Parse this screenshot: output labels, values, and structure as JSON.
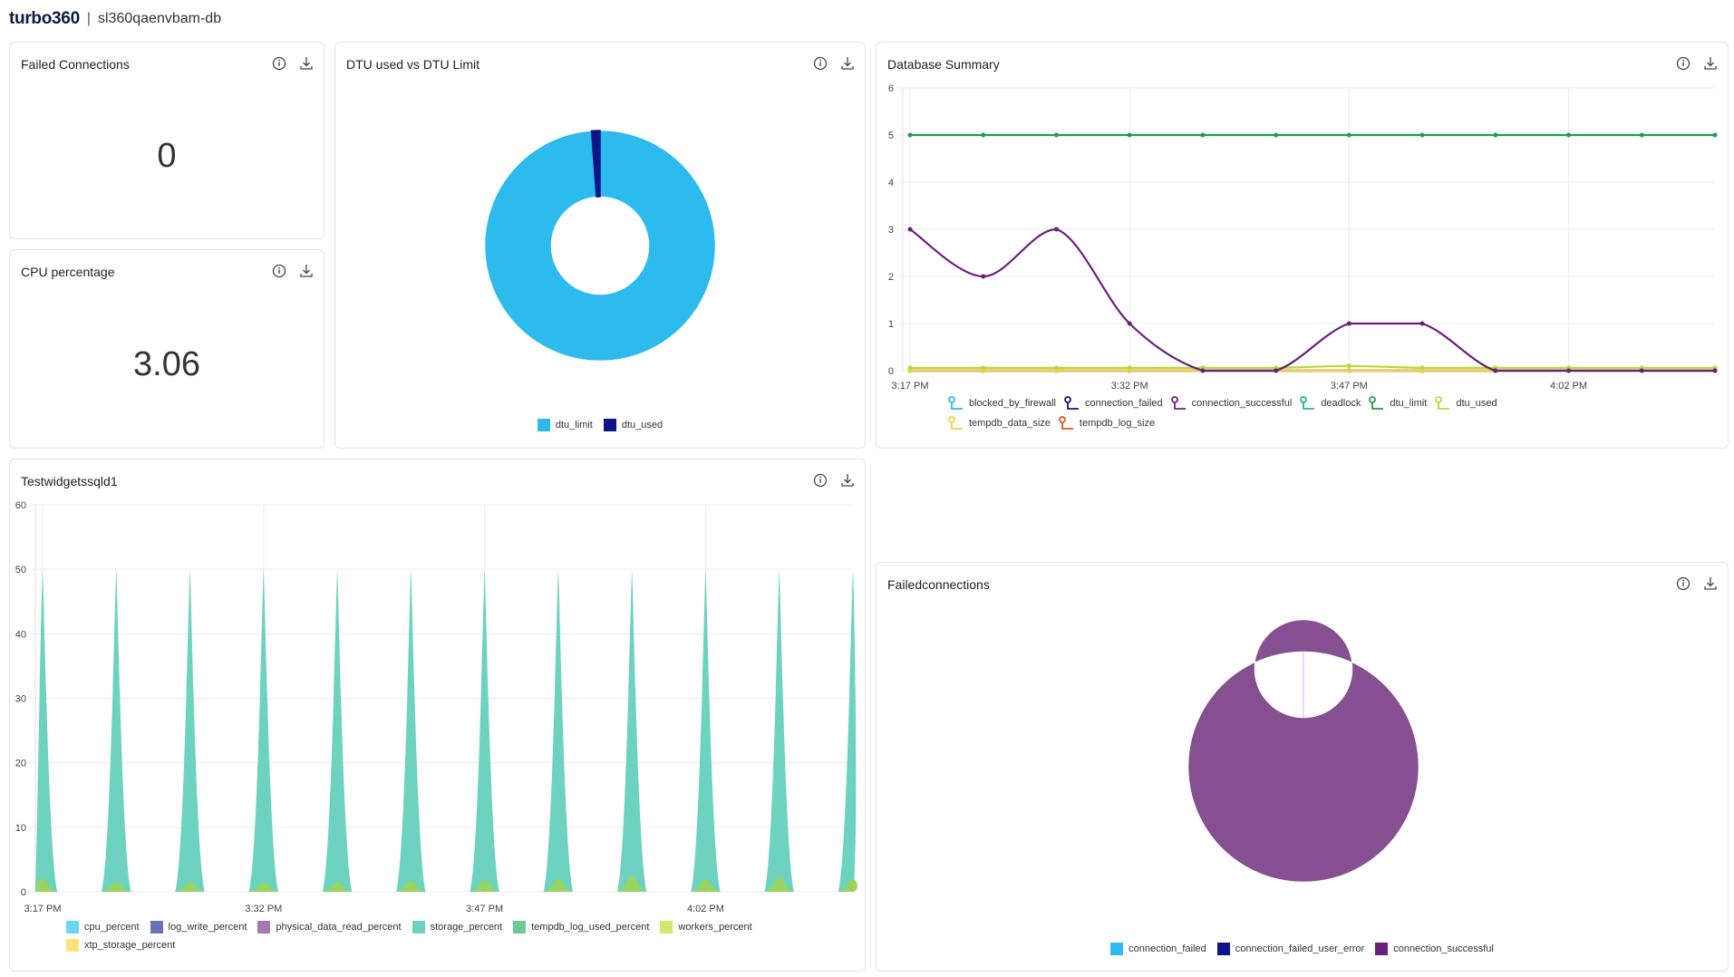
{
  "header": {
    "brand": "turbo360",
    "separator": "|",
    "resource": "sl360qaenvbam-db"
  },
  "panels": {
    "failed_connections": {
      "title": "Failed Connections",
      "value": "0"
    },
    "cpu_percentage": {
      "title": "CPU percentage",
      "value": "3.06"
    },
    "dtu": {
      "title": "DTU used vs DTU Limit"
    },
    "db_summary": {
      "title": "Database Summary"
    },
    "testwidgets": {
      "title": "Testwidgetssqld1"
    },
    "failedconnections2": {
      "title": "Failedconnections"
    }
  },
  "icons": {
    "info": "info-icon",
    "download": "download-icon"
  },
  "chart_data": [
    {
      "id": "dtu",
      "type": "pie",
      "donut": true,
      "title": "DTU used vs DTU Limit",
      "labels": [
        "dtu_limit",
        "dtu_used"
      ],
      "values": [
        5,
        0.06
      ],
      "colors": [
        "#2dbaed",
        "#0c1487"
      ],
      "legend": "bottom"
    },
    {
      "id": "db_summary",
      "type": "line",
      "title": "Database Summary",
      "x": [
        "3:17 PM",
        "3:22 PM",
        "3:27 PM",
        "3:32 PM",
        "3:37 PM",
        "3:42 PM",
        "3:47 PM",
        "3:52 PM",
        "3:57 PM",
        "4:02 PM",
        "4:07 PM",
        "4:12 PM"
      ],
      "xticks": [
        "3:17 PM",
        "3:32 PM",
        "3:47 PM",
        "4:02 PM"
      ],
      "ylim": [
        0,
        6
      ],
      "yticks": [
        0,
        1,
        2,
        3,
        4,
        5,
        6
      ],
      "grid": true,
      "legend": "bottom",
      "series": [
        {
          "name": "blocked_by_firewall",
          "color": "#2dbaed",
          "values": [
            0,
            0,
            0,
            0,
            0,
            0,
            0,
            0,
            0,
            0,
            0,
            0
          ]
        },
        {
          "name": "connection_failed",
          "color": "#0c1487",
          "values": [
            0,
            0,
            0,
            0,
            0,
            0,
            0,
            0,
            0,
            0,
            0,
            0
          ]
        },
        {
          "name": "connection_successful",
          "color": "#6a1f7a",
          "values": [
            3,
            2,
            3,
            1,
            0,
            0,
            1,
            1,
            0,
            0,
            0,
            0
          ]
        },
        {
          "name": "deadlock",
          "color": "#1fb59a",
          "values": [
            0,
            0,
            0,
            0,
            0,
            0,
            0,
            0,
            0,
            0,
            0,
            0
          ]
        },
        {
          "name": "dtu_limit",
          "color": "#1f9e4f",
          "values": [
            5,
            5,
            5,
            5,
            5,
            5,
            5,
            5,
            5,
            5,
            5,
            5
          ]
        },
        {
          "name": "dtu_used",
          "color": "#b8d935",
          "values": [
            0.06,
            0.06,
            0.06,
            0.06,
            0.06,
            0.06,
            0.1,
            0.06,
            0.06,
            0.06,
            0.06,
            0.06
          ]
        },
        {
          "name": "tempdb_data_size",
          "color": "#f4d03f",
          "values": [
            0,
            0,
            0,
            0,
            0,
            0,
            0,
            0,
            0,
            0,
            0,
            0
          ]
        },
        {
          "name": "tempdb_log_size",
          "color": "#e8541f",
          "values": [
            0,
            0,
            0,
            0,
            0,
            0,
            0,
            0,
            0,
            0,
            0,
            0
          ]
        }
      ]
    },
    {
      "id": "testwidgets",
      "type": "area",
      "title": "Testwidgetssqld1",
      "x": [
        "3:17 PM",
        "3:22 PM",
        "3:27 PM",
        "3:32 PM",
        "3:37 PM",
        "3:42 PM",
        "3:47 PM",
        "3:52 PM",
        "3:57 PM",
        "4:02 PM",
        "4:07 PM",
        "4:12 PM"
      ],
      "xticks": [
        "3:17 PM",
        "3:32 PM",
        "3:47 PM",
        "4:02 PM"
      ],
      "ylim": [
        0,
        60
      ],
      "yticks": [
        0,
        10,
        20,
        30,
        40,
        50,
        60
      ],
      "grid": true,
      "legend": "bottom",
      "series": [
        {
          "name": "cpu_percent",
          "color": "#6dd5f5",
          "values": [
            0,
            0,
            0,
            0,
            0,
            0,
            0,
            0,
            0,
            0,
            0,
            0
          ]
        },
        {
          "name": "log_write_percent",
          "color": "#6a72b8",
          "values": [
            0,
            0,
            0,
            0,
            0,
            0,
            0,
            0,
            0,
            0,
            0,
            0
          ]
        },
        {
          "name": "physical_data_read_percent",
          "color": "#a37ab0",
          "values": [
            0,
            0,
            0,
            0,
            0,
            0,
            0,
            0,
            0,
            0,
            0,
            0
          ]
        },
        {
          "name": "storage_percent",
          "color": "#6dd3c0",
          "values": [
            50,
            50,
            50,
            50,
            50,
            50,
            50,
            50,
            50,
            50,
            50,
            50
          ]
        },
        {
          "name": "tempdb_log_used_percent",
          "color": "#6cc895",
          "values": [
            0,
            0,
            0,
            0,
            0,
            0,
            0,
            0,
            0,
            0,
            0,
            0
          ]
        },
        {
          "name": "workers_percent",
          "color": "#d6e76e",
          "values": [
            2,
            1.5,
            1.5,
            1.5,
            1.5,
            1.7,
            1.8,
            2,
            2.5,
            2,
            2.3,
            2
          ]
        },
        {
          "name": "xtp_storage_percent",
          "color": "#fbe27a",
          "values": [
            0,
            0,
            0,
            0,
            0,
            0,
            0,
            0,
            0,
            0,
            0,
            0
          ]
        }
      ]
    },
    {
      "id": "failedconnections2",
      "type": "pie",
      "donut": true,
      "title": "Failedconnections",
      "labels": [
        "connection_failed",
        "connection_failed_user_error",
        "connection_successful"
      ],
      "values": [
        0,
        0,
        11
      ],
      "colors": [
        "#2dbaed",
        "#0c1487",
        "#864f91"
      ],
      "legend_colors": [
        "#2dbaed",
        "#0c1487",
        "#6a1f7a"
      ],
      "legend": "bottom"
    }
  ]
}
